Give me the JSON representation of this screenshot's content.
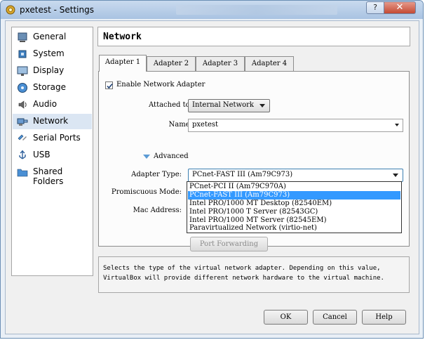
{
  "window": {
    "title": "pxetest - Settings",
    "help_label": "?",
    "close_label": "✕"
  },
  "sidebar": {
    "items": [
      {
        "label": "General",
        "icon": "general-icon"
      },
      {
        "label": "System",
        "icon": "system-icon"
      },
      {
        "label": "Display",
        "icon": "display-icon"
      },
      {
        "label": "Storage",
        "icon": "storage-icon"
      },
      {
        "label": "Audio",
        "icon": "audio-icon"
      },
      {
        "label": "Network",
        "icon": "network-icon",
        "selected": true
      },
      {
        "label": "Serial Ports",
        "icon": "serial-ports-icon"
      },
      {
        "label": "USB",
        "icon": "usb-icon"
      },
      {
        "label": "Shared Folders",
        "icon": "shared-folders-icon"
      }
    ]
  },
  "section_title": "Network",
  "tabs": [
    "Adapter 1",
    "Adapter 2",
    "Adapter 3",
    "Adapter 4"
  ],
  "active_tab": "Adapter 1",
  "form": {
    "enable_label": "Enable Network Adapter",
    "enabled": true,
    "attached_label": "Attached to:",
    "attached_value": "Internal Network",
    "name_label": "Name:",
    "name_value": "pxetest",
    "advanced_label": "Advanced",
    "adapter_type_label": "Adapter Type:",
    "adapter_type_value": "PCnet-FAST III (Am79C973)",
    "promiscuous_label": "Promiscuous Mode:",
    "mac_label": "Mac Address:",
    "port_forwarding_label": "Port Forwarding"
  },
  "dropdown": {
    "options": [
      "PCnet-PCI II (Am79C970A)",
      "PCnet-FAST III (Am79C973)",
      "Intel PRO/1000 MT Desktop (82540EM)",
      "Intel PRO/1000 T Server (82543GC)",
      "Intel PRO/1000 MT Server (82545EM)",
      "Paravirtualized Network (virtio-net)"
    ],
    "highlighted": "PCnet-FAST III (Am79C973)"
  },
  "description": "Selects the type of the virtual network adapter. Depending on this value,\nVirtualBox will provide different network hardware to the virtual machine.",
  "buttons": {
    "ok": "OK",
    "cancel": "Cancel",
    "help": "Help"
  },
  "colors": {
    "selection": "#3399ff",
    "sidebar_selected": "#dbe6f3",
    "titlebar": "#b9cfe9"
  }
}
